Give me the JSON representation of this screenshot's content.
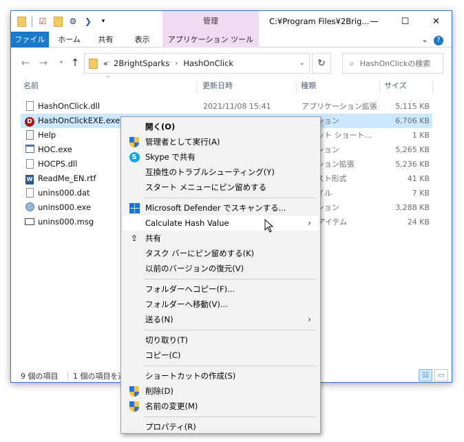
{
  "titlebar": {
    "contextual_tab": "管理",
    "path": "C:¥Program Files¥2Brig...",
    "minimize": "—",
    "maximize": "☐",
    "close": "✕"
  },
  "ribbon": {
    "tabs": [
      "ファイル",
      "ホーム",
      "共有",
      "表示",
      "アプリケーション ツール"
    ],
    "collapse": "⌄",
    "help": "?"
  },
  "address": {
    "chevrons": "«",
    "crumbs": [
      "2BrightSparks",
      "HashOnClick"
    ],
    "separator": "›",
    "search_placeholder": "HashOnClickの検索"
  },
  "columns": [
    "名前",
    "更新日時",
    "種類",
    "サイズ"
  ],
  "files": [
    {
      "name": "HashOnClick.dll",
      "date": "2021/11/08 15:41",
      "type": "アプリケーション拡張",
      "size": "5,115 KB",
      "icon": "dll-icon"
    },
    {
      "name": "HashOnClickEXE.exe",
      "date": "",
      "type": "ケーション",
      "size": "6,706 KB",
      "icon": "hashonclick-app-icon",
      "selected": true
    },
    {
      "name": "Help",
      "date": "",
      "type": "ーネット ショート...",
      "size": "1 KB",
      "icon": "help-shortcut-icon"
    },
    {
      "name": "HOC.exe",
      "date": "",
      "type": "ケーション",
      "size": "5,265 KB",
      "icon": "exe-icon"
    },
    {
      "name": "HOCPS.dll",
      "date": "",
      "type": "ケーション拡張",
      "size": "5,236 KB",
      "icon": "dll-icon"
    },
    {
      "name": "ReadMe_EN.rtf",
      "date": "",
      "type": "テキスト形式",
      "size": "41 KB",
      "icon": "word-document-icon"
    },
    {
      "name": "unins000.dat",
      "date": "",
      "type": "ファイル",
      "size": "7 KB",
      "icon": "dat-file-icon"
    },
    {
      "name": "unins000.exe",
      "date": "",
      "type": "ケーション",
      "size": "3,288 KB",
      "icon": "setup-icon"
    },
    {
      "name": "unins000.msg",
      "date": "",
      "type": "ook アイテム",
      "size": "24 KB",
      "icon": "mail-icon"
    }
  ],
  "status": {
    "count": "9 個の項目",
    "selected": "1 個の項目を選"
  },
  "context_menu": {
    "items": [
      {
        "label": "開く(O)",
        "icon": ""
      },
      {
        "label": "管理者として実行(A)",
        "icon": "uac-shield-icon"
      },
      {
        "label": "Skype で共有",
        "icon": "skype-icon"
      },
      {
        "label": "互換性のトラブルシューティング(Y)",
        "icon": ""
      },
      {
        "label": "スタート メニューにピン留めする",
        "icon": ""
      },
      {
        "label": "Microsoft Defender でスキャンする...",
        "icon": "defender-icon"
      },
      {
        "label": "Calculate Hash Value",
        "icon": "",
        "submenu": true
      },
      {
        "label": "共有",
        "icon": "share-icon"
      },
      {
        "label": "タスク バーにピン留めする(K)",
        "icon": ""
      },
      {
        "label": "以前のバージョンの復元(V)",
        "icon": ""
      },
      {
        "label": "フォルダーへコピー(F)...",
        "icon": ""
      },
      {
        "label": "フォルダーへ移動(V)...",
        "icon": ""
      },
      {
        "label": "送る(N)",
        "icon": "",
        "submenu": true
      },
      {
        "label": "切り取り(T)",
        "icon": ""
      },
      {
        "label": "コピー(C)",
        "icon": ""
      },
      {
        "label": "ショートカットの作成(S)",
        "icon": ""
      },
      {
        "label": "削除(D)",
        "icon": "uac-shield-icon"
      },
      {
        "label": "名前の変更(M)",
        "icon": "uac-shield-icon"
      },
      {
        "label": "プロパティ(R)",
        "icon": ""
      }
    ],
    "submenu_arrow": "›"
  },
  "colors": {
    "file_tab": "#1979ca",
    "contextual_tab": "#f1dbf3",
    "selection": "#cce8ff",
    "window_border": "#2b79d8"
  }
}
